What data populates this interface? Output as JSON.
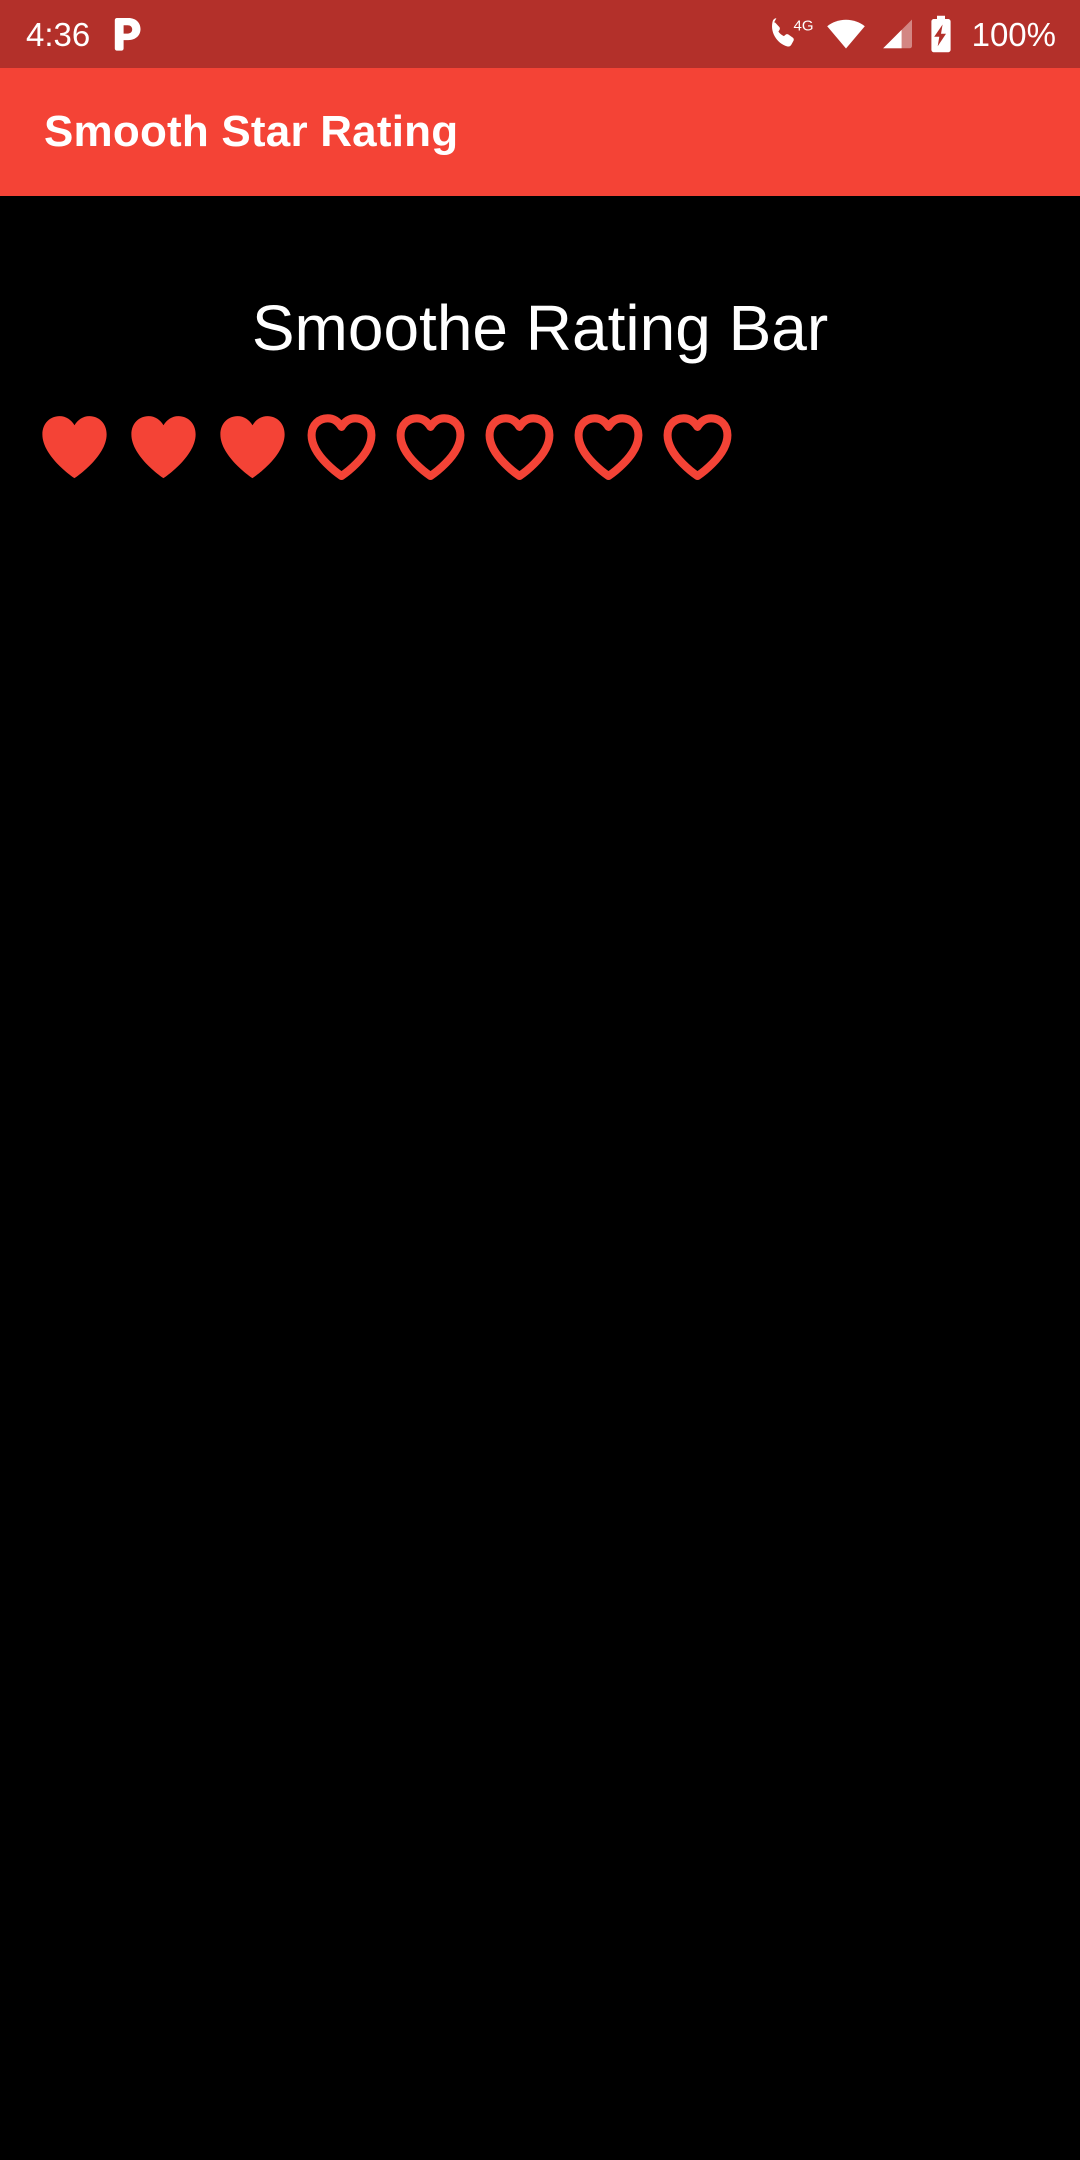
{
  "status_bar": {
    "time": "4:36",
    "notification_icon": "pandora-p-icon",
    "network_label": "4G",
    "call_icon": "phone-call-icon",
    "wifi_icon": "wifi-full-icon",
    "signal_icon": "cellular-signal-icon",
    "battery_icon": "battery-charging-icon",
    "battery_text": "100%",
    "background_color": "#b3302a",
    "foreground_color": "#ffffff"
  },
  "app_bar": {
    "title": "Smooth Star Rating",
    "background_color": "#f44336",
    "title_color": "#ffffff"
  },
  "content": {
    "heading": "Smoothe Rating Bar",
    "background_color": "#000000",
    "heading_color": "#ffffff"
  },
  "rating": {
    "name": "smoothe-rating-bar",
    "icon_shape": "heart-icon",
    "max": 8,
    "value": 3,
    "accent_color": "#f44336",
    "items": [
      {
        "index": 1,
        "state": "filled"
      },
      {
        "index": 2,
        "state": "filled"
      },
      {
        "index": 3,
        "state": "filled"
      },
      {
        "index": 4,
        "state": "empty"
      },
      {
        "index": 5,
        "state": "empty"
      },
      {
        "index": 6,
        "state": "empty"
      },
      {
        "index": 7,
        "state": "empty"
      },
      {
        "index": 8,
        "state": "empty"
      }
    ]
  }
}
